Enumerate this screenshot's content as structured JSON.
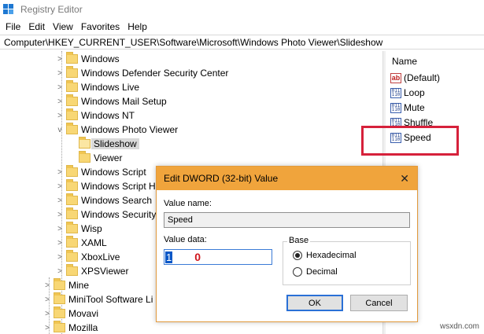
{
  "window": {
    "title": "Registry Editor"
  },
  "menu": [
    "File",
    "Edit",
    "View",
    "Favorites",
    "Help"
  ],
  "address": "Computer\\HKEY_CURRENT_USER\\Software\\Microsoft\\Windows Photo Viewer\\Slideshow",
  "tree": [
    {
      "label": "Windows",
      "chevron": ">"
    },
    {
      "label": "Windows Defender Security Center",
      "chevron": ">"
    },
    {
      "label": "Windows Live",
      "chevron": ">"
    },
    {
      "label": "Windows Mail Setup",
      "chevron": ">"
    },
    {
      "label": "Windows NT",
      "chevron": ">"
    },
    {
      "label": "Windows Photo Viewer",
      "chevron": "v"
    },
    {
      "label": "Slideshow",
      "chevron": ""
    },
    {
      "label": "Viewer",
      "chevron": ""
    },
    {
      "label": "Windows Script",
      "chevron": ">"
    },
    {
      "label": "Windows Script H",
      "chevron": ">"
    },
    {
      "label": "Windows Search",
      "chevron": ">"
    },
    {
      "label": "Windows Security",
      "chevron": ">"
    },
    {
      "label": "Wisp",
      "chevron": ">"
    },
    {
      "label": "XAML",
      "chevron": ">"
    },
    {
      "label": "XboxLive",
      "chevron": ">"
    },
    {
      "label": "XPSViewer",
      "chevron": ">"
    },
    {
      "label": "Mine",
      "chevron": ">"
    },
    {
      "label": "MiniTool Software Li",
      "chevron": ">"
    },
    {
      "label": "Movavi",
      "chevron": ">"
    },
    {
      "label": "Mozilla",
      "chevron": ">"
    }
  ],
  "values_pane": {
    "column_name": "Name",
    "items": [
      {
        "name": "(Default)",
        "icon": "ab"
      },
      {
        "name": "Loop",
        "icon": "dword"
      },
      {
        "name": "Mute",
        "icon": "dword"
      },
      {
        "name": "Shuffle",
        "icon": "dword"
      },
      {
        "name": "Speed",
        "icon": "dword"
      }
    ]
  },
  "dialog": {
    "title": "Edit DWORD (32-bit) Value",
    "close_glyph": "✕",
    "value_name_label": "Value name:",
    "value_name": "Speed",
    "value_data_label": "Value data:",
    "value_data_selected": "1",
    "annotation": "0",
    "base_label": "Base",
    "base_hex": "Hexadecimal",
    "base_dec": "Decimal",
    "base_selected": "Hexadecimal",
    "ok_label": "OK",
    "cancel_label": "Cancel"
  },
  "colors": {
    "dialog_title_bg": "#f0a43c",
    "highlight_box": "#d6213b",
    "selection": "#0a57c7"
  },
  "watermark": "wsxdn.com"
}
